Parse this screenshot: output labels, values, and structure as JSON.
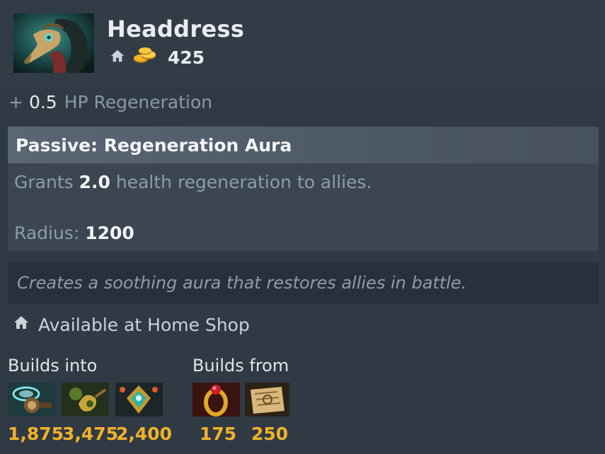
{
  "item": {
    "name": "Headdress",
    "icon": "headdress-item-icon",
    "cost": "425"
  },
  "attribute": {
    "plus": "+",
    "value": "0.5",
    "label": "HP Regeneration"
  },
  "ability": {
    "title": "Passive: Regeneration Aura",
    "desc_before": "Grants",
    "desc_value": "2.0",
    "desc_after": "health regeneration to allies.",
    "radius_label": "Radius:",
    "radius_value": "1200"
  },
  "lore": "Creates a soothing aura that restores allies in battle.",
  "shop": "Available at Home Shop",
  "builds_into": {
    "label": "Builds into",
    "items": [
      {
        "icon": "mekansm-item-icon",
        "price": "1,875"
      },
      {
        "icon": "pipe-item-icon",
        "price": "3,475"
      },
      {
        "icon": "holy-locket-item-icon",
        "price": "2,400"
      }
    ]
  },
  "builds_from": {
    "label": "Builds from",
    "items": [
      {
        "icon": "ring-of-regen-item-icon",
        "price": "175"
      },
      {
        "icon": "recipe-scroll-icon",
        "price": "250"
      }
    ]
  },
  "colors": {
    "background": "#303a45",
    "gold": "#f0b229",
    "ability_bg": "#3b4652",
    "lore_bg": "#28313b"
  }
}
